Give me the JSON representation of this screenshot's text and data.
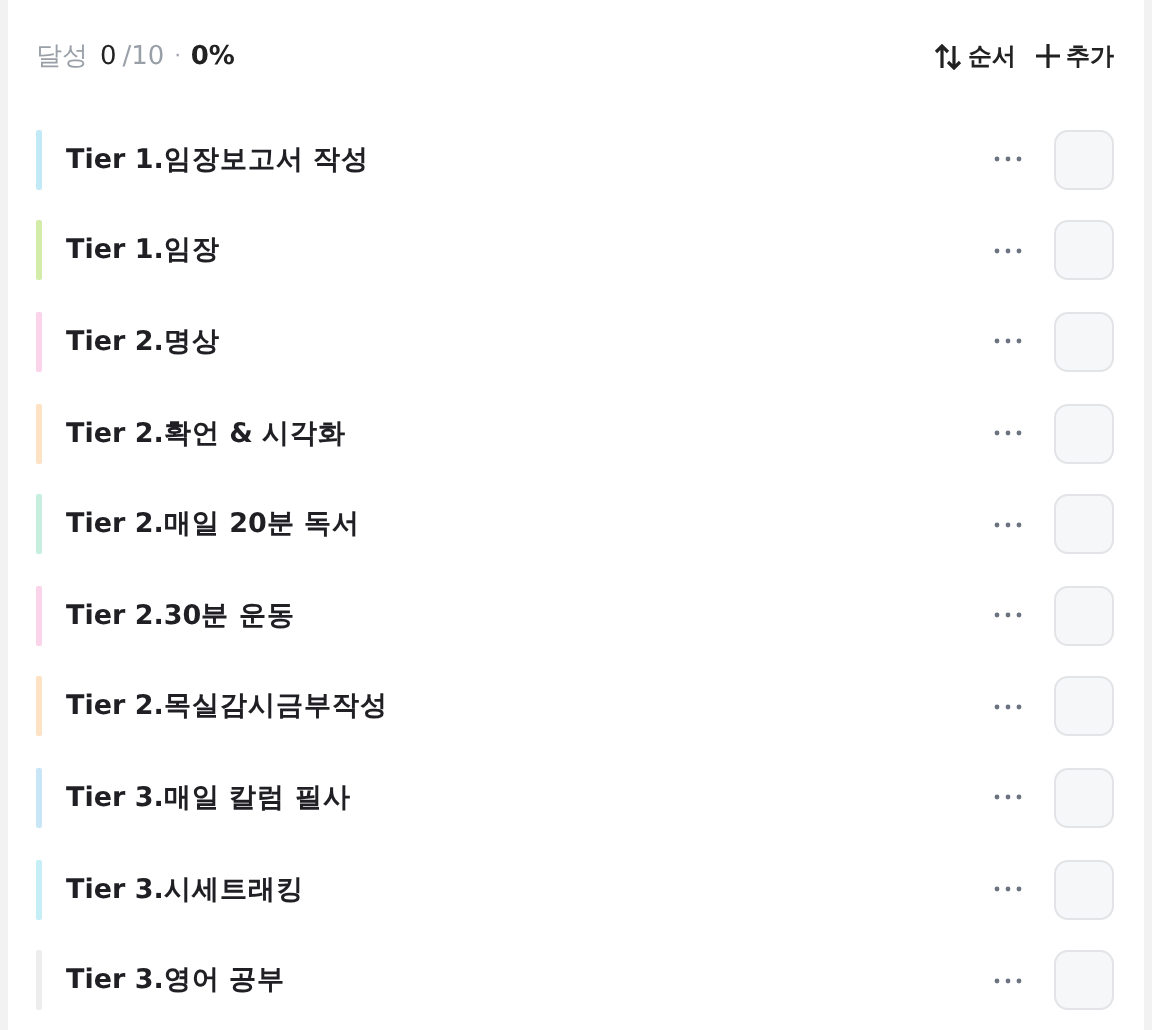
{
  "summary": {
    "label": "달성",
    "done": "0",
    "total": "/10",
    "separator": "·",
    "percent": "0%"
  },
  "actions": [
    {
      "kind": "sort",
      "label": "순서"
    },
    {
      "kind": "add",
      "label": "추가"
    }
  ],
  "habits": [
    {
      "title": "Tier 1.임장보고서 작성",
      "color": "#c2eaf6",
      "checked": false
    },
    {
      "title": "Tier 1.임장",
      "color": "#d3ecaa",
      "checked": false
    },
    {
      "title": "Tier 2.명상",
      "color": "#fbd3ea",
      "checked": false
    },
    {
      "title": "Tier 2.확언 & 시각화",
      "color": "#fde2c4",
      "checked": false
    },
    {
      "title": "Tier 2.매일 20분 독서",
      "color": "#c6efdf",
      "checked": false
    },
    {
      "title": "Tier 2.30분 운동",
      "color": "#fbd3ea",
      "checked": false
    },
    {
      "title": "Tier 2.목실감시금부작성",
      "color": "#fde2c4",
      "checked": false
    },
    {
      "title": "Tier 3.매일 칼럼 필사",
      "color": "#c9e5f8",
      "checked": false
    },
    {
      "title": "Tier 3.시세트래킹",
      "color": "#c6eef7",
      "checked": false
    },
    {
      "title": "Tier 3.영어 공부",
      "color": "#ededed",
      "checked": false
    }
  ]
}
